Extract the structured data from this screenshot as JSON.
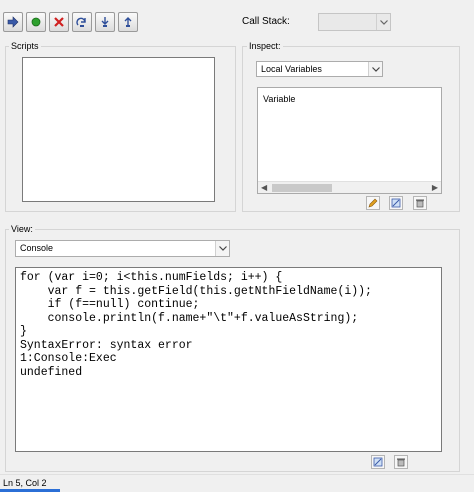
{
  "toolbar": {
    "buttons": [
      {
        "name": "resume-icon"
      },
      {
        "name": "stop-icon"
      },
      {
        "name": "clear-icon"
      },
      {
        "name": "step-over-icon"
      },
      {
        "name": "step-into-icon"
      },
      {
        "name": "step-out-icon"
      }
    ]
  },
  "callstack": {
    "label": "Call Stack:",
    "value": ""
  },
  "scripts": {
    "label": "Scripts"
  },
  "inspect": {
    "label": "Inspect:",
    "dropdown_value": "Local Variables",
    "column_header": "Variable",
    "buttons": [
      "edit-icon",
      "watch-icon",
      "delete-icon"
    ]
  },
  "view": {
    "label": "View:",
    "dropdown_value": "Console",
    "lines": [
      "for (var i=0; i<this.numFields; i++) {",
      "    var f = this.getField(this.getNthFieldName(i));",
      "    if (f==null) continue;",
      "    console.println(f.name+\"\\t\"+f.valueAsString);",
      "}",
      "SyntaxError: syntax error",
      "1:Console:Exec",
      "undefined"
    ],
    "buttons": [
      "clear-console-icon",
      "trash-icon"
    ]
  },
  "status": {
    "position": "Ln 5, Col 2"
  },
  "colors": {
    "accent": "#2b6fd6",
    "stop": "#2ea02e",
    "clear": "#d02020"
  }
}
